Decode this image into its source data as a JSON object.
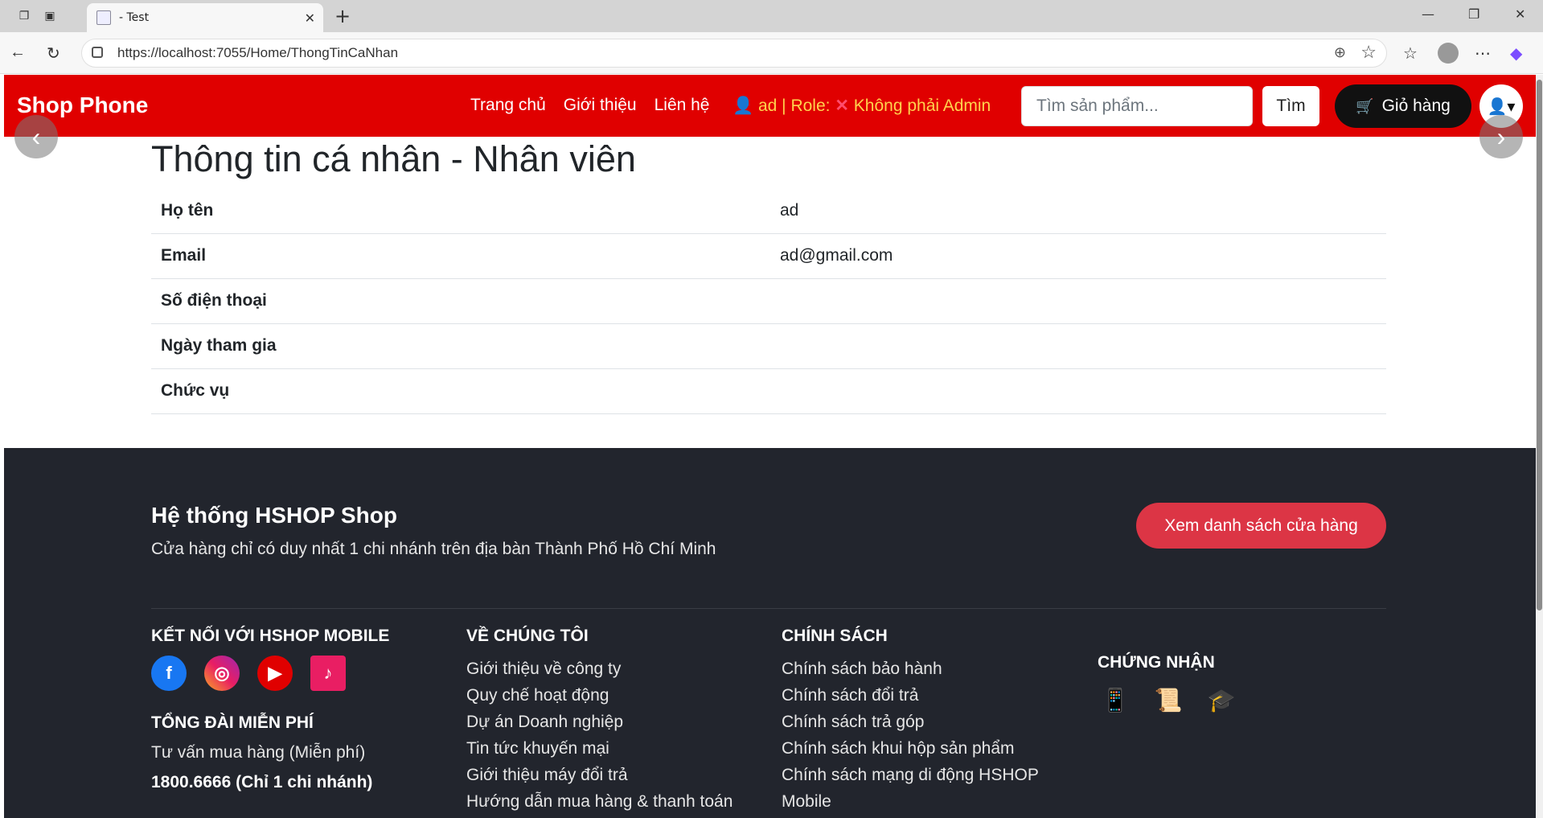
{
  "browser": {
    "tab_title": "- Test",
    "url_host": "https://localhost:7055",
    "url_path": "/Home/ThongTinCaNhan",
    "new_tab": "+",
    "tab_close": "✕"
  },
  "nav": {
    "brand": "Shop Phone",
    "links": [
      "Trang chủ",
      "Giới thiệu",
      "Liên hệ"
    ],
    "user_prefix": "👤 ad | Role: ",
    "role_mark": "✕",
    "role_text": " Không phải Admin",
    "search_placeholder": "Tìm sản phẩm...",
    "search_button": "Tìm",
    "cart_label": "Giỏ hàng"
  },
  "page": {
    "heading": "Thông tin cá nhân - Nhân viên",
    "rows": [
      {
        "label": "Họ tên",
        "value": "ad"
      },
      {
        "label": "Email",
        "value": "ad@gmail.com"
      },
      {
        "label": "Số điện thoại",
        "value": ""
      },
      {
        "label": "Ngày tham gia",
        "value": ""
      },
      {
        "label": "Chức vụ",
        "value": ""
      }
    ]
  },
  "footer": {
    "title": "Hệ thống HSHOP Shop",
    "subtitle": "Cửa hàng chỉ có duy nhất 1 chi nhánh trên địa bàn Thành Phố Hồ Chí Minh",
    "store_button": "Xem danh sách cửa hàng",
    "connect_heading": "KẾT NỐI VỚI HSHOP MOBILE",
    "hotline_heading": "TỔNG ĐÀI MIỄN PHÍ",
    "hotline_desc": "Tư vấn mua hàng (Miễn phí)",
    "hotline_number": "1800.6666 (Chỉ 1 chi nhánh)",
    "about_heading": "VỀ CHÚNG TÔI",
    "about_links": [
      "Giới thiệu về công ty",
      "Quy chế hoạt động",
      "Dự án Doanh nghiệp",
      "Tin tức khuyến mại",
      "Giới thiệu máy đổi trả",
      "Hướng dẫn mua hàng & thanh toán"
    ],
    "policy_heading": "CHÍNH SÁCH",
    "policy_links": [
      "Chính sách bảo hành",
      "Chính sách đổi trả",
      "Chính sách trả góp",
      "Chính sách khui hộp sản phẩm",
      "Chính sách mạng di động HSHOP",
      "Mobile"
    ],
    "cert_heading": "CHỨNG NHẬN"
  },
  "colors": {
    "navbar": "#e00000",
    "footer": "#22252d",
    "accent_button": "#dc3545"
  },
  "icons": [
    "facebook-icon",
    "instagram-icon",
    "youtube-icon",
    "tiktok-icon",
    "cart-icon",
    "user-icon"
  ]
}
